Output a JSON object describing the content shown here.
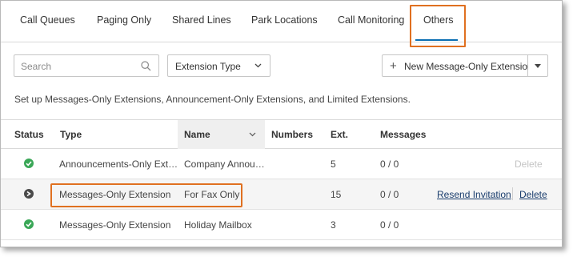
{
  "tabs": [
    {
      "label": "Call Queues"
    },
    {
      "label": "Paging Only"
    },
    {
      "label": "Shared Lines"
    },
    {
      "label": "Park Locations"
    },
    {
      "label": "Call Monitoring"
    },
    {
      "label": "Others"
    }
  ],
  "active_tab": "Others",
  "toolbar": {
    "search_placeholder": "Search",
    "extension_type_label": "Extension Type",
    "new_button_label": "New Message-Only Extension"
  },
  "description": "Set up Messages-Only Extensions, Announcement-Only Extensions, and Limited Extensions.",
  "table": {
    "headers": {
      "status": "Status",
      "type": "Type",
      "name": "Name",
      "numbers": "Numbers",
      "ext": "Ext.",
      "messages": "Messages"
    },
    "rows": [
      {
        "status": "active",
        "type": "Announcements-Only Ext…",
        "name": "Company Annou…",
        "numbers": "",
        "ext": "5",
        "messages": "0 / 0",
        "resend": "",
        "delete": "Delete",
        "delete_enabled": false
      },
      {
        "status": "pending",
        "type": "Messages-Only Extension",
        "name": "For Fax Only",
        "numbers": "",
        "ext": "15",
        "messages": "0 / 0",
        "resend": "Resend Invitation",
        "delete": "Delete",
        "delete_enabled": true
      },
      {
        "status": "active",
        "type": "Messages-Only Extension",
        "name": "Holiday Mailbox",
        "numbers": "",
        "ext": "3",
        "messages": "0 / 0",
        "resend": "",
        "delete": "",
        "delete_enabled": false
      }
    ]
  },
  "colors": {
    "highlight": "#e07020",
    "tab_underline": "#0b6fb3",
    "status_active": "#3aa757",
    "status_pending": "#4a4a4a",
    "link": "#1a3d6d"
  }
}
